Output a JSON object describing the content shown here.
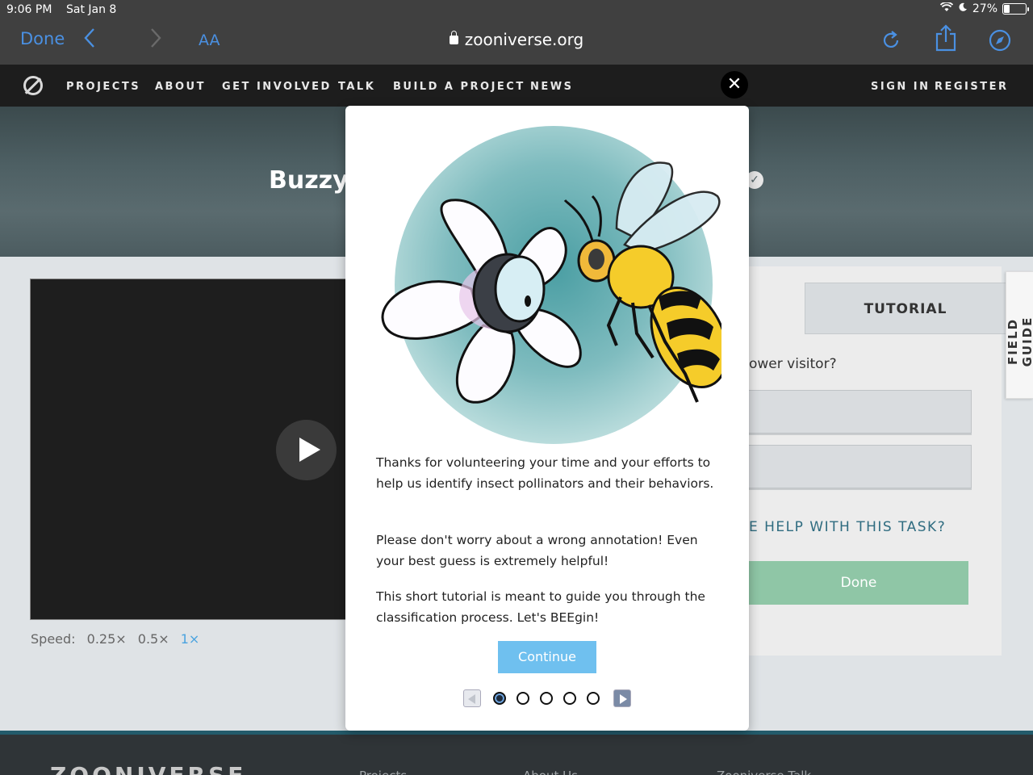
{
  "statusbar": {
    "time": "9:06 PM",
    "date": "Sat Jan 8",
    "battery": "27%",
    "battery_level": 0.27
  },
  "browser": {
    "done_label": "Done",
    "text_size_label": "AA",
    "url": "zooniverse.org"
  },
  "nav": {
    "items": [
      "PROJECTS",
      "ABOUT",
      "GET INVOLVED",
      "TALK",
      "BUILD A PROJECT",
      "NEWS"
    ],
    "sign_in": "SIGN IN",
    "register": "REGISTER"
  },
  "hero": {
    "title": "Buzzy"
  },
  "player": {
    "speed_label": "Speed:",
    "speeds": [
      "0.25×",
      "0.5×",
      "1×"
    ],
    "active_speed": "1×"
  },
  "task": {
    "tutorial_tab": "TUTORIAL",
    "question_fragment": "ower visitor?",
    "help_fragment": "E HELP WITH THIS TASK?",
    "done_label": "Done",
    "field_guide": "FIELD GUIDE"
  },
  "modal": {
    "paragraphs": [
      "Thanks for volunteering your time and your efforts to help us identify insect pollinators and their behaviors.",
      "Please don't worry about a wrong annotation! Even your best guess is extremely helpful!",
      "This short tutorial is meant to guide you through the classification process. Let's BEEgin!"
    ],
    "continue_label": "Continue",
    "pages_total": 5,
    "current_page": 1
  },
  "footer": {
    "brand": "ZOONIVERSE",
    "links": [
      "Projects",
      "About Us",
      "Zooniverse Talk"
    ]
  },
  "colors": {
    "accent_link": "#4a90e2",
    "continue_button": "#6fc0ef",
    "done_button": "#8fc6a6",
    "help_text": "#2f6c80"
  }
}
